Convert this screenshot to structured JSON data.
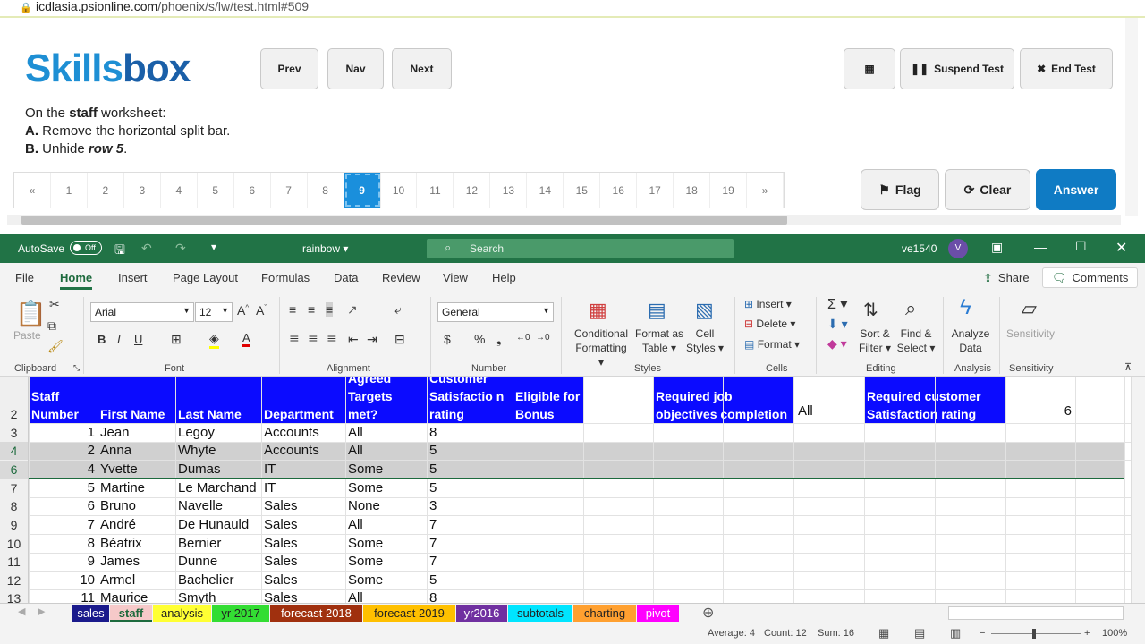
{
  "browser": {
    "url_host": "icdlasia.psionline.com",
    "url_path": "/phoenix/s/lw/test.html#509"
  },
  "skillsbox": {
    "logo_part1": "Skills",
    "logo_part2": "box",
    "nav": {
      "prev": "Prev",
      "nav": "Nav",
      "next": "Next"
    },
    "calculator_icon": "calculator-icon",
    "suspend": "Suspend Test",
    "end": "End Test",
    "instruction": {
      "intro_pre": "On the ",
      "intro_bold": "staff",
      "intro_post": " worksheet:",
      "a_label": "A.",
      "a_text": " Remove the horizontal split bar.",
      "b_label": "B.",
      "b_text_pre": " Unhide ",
      "b_text_bold": "row 5",
      "b_text_post": "."
    },
    "pages": [
      "«",
      "1",
      "2",
      "3",
      "4",
      "5",
      "6",
      "7",
      "8",
      "9",
      "10",
      "11",
      "12",
      "13",
      "14",
      "15",
      "16",
      "17",
      "18",
      "19",
      "»"
    ],
    "active_page": "9",
    "flag": "Flag",
    "clear": "Clear",
    "answer": "Answer"
  },
  "excel": {
    "autosave": "AutoSave",
    "autosave_state": "Off",
    "filename": "rainbow",
    "search_placeholder": "Search",
    "user": "ve1540",
    "user_initial": "V",
    "menu": [
      "File",
      "Home",
      "Insert",
      "Page Layout",
      "Formulas",
      "Data",
      "Review",
      "View",
      "Help"
    ],
    "share": "Share",
    "comments": "Comments",
    "ribbon": {
      "paste": "Paste",
      "clipboard": "Clipboard",
      "font_name": "Arial",
      "font_size": "12",
      "font": "Font",
      "alignment": "Alignment",
      "number_format": "General",
      "number": "Number",
      "cond_fmt_1": "Conditional",
      "cond_fmt_2": "Formatting",
      "fmt_table_1": "Format as",
      "fmt_table_2": "Table",
      "cell_styles_1": "Cell",
      "cell_styles_2": "Styles",
      "styles": "Styles",
      "insert": "Insert",
      "delete": "Delete",
      "format": "Format",
      "cells": "Cells",
      "sort_1": "Sort &",
      "sort_2": "Filter",
      "find_1": "Find &",
      "find_2": "Select",
      "editing": "Editing",
      "analyze_1": "Analyze",
      "analyze_2": "Data",
      "analysis": "Analysis",
      "sensitivity": "Sensitivity",
      "sensitivity_grp": "Sensitivity"
    },
    "sheet": {
      "row_numbers": [
        "2",
        "3",
        "4",
        "6",
        "7",
        "8",
        "9",
        "10",
        "11",
        "12",
        "13"
      ],
      "header": {
        "staff_number": "Staff Number",
        "first_name": "First Name",
        "last_name": "Last Name",
        "department": "Department",
        "agreed": "Agreed Targets met?",
        "customer": "Customer Satisfactio n rating",
        "eligible": "Eligible for Bonus",
        "required_job": "Required job objectives completion",
        "all": "All",
        "required_cust": "Required customer Satisfaction rating",
        "six": "6"
      },
      "rows": [
        {
          "no": "1",
          "first": "Jean",
          "last": "Legoy",
          "dept": "Accounts",
          "met": "All",
          "rating": "8"
        },
        {
          "no": "2",
          "first": "Anna",
          "last": "Whyte",
          "dept": "Accounts",
          "met": "All",
          "rating": "5"
        },
        {
          "no": "4",
          "first": "Yvette",
          "last": "Dumas",
          "dept": "IT",
          "met": "Some",
          "rating": "5"
        },
        {
          "no": "5",
          "first": "Martine",
          "last": "Le Marchand",
          "dept": "IT",
          "met": "Some",
          "rating": "5"
        },
        {
          "no": "6",
          "first": "Bruno",
          "last": "Navelle",
          "dept": "Sales",
          "met": "None",
          "rating": "3"
        },
        {
          "no": "7",
          "first": "André",
          "last": "De Hunauld",
          "dept": "Sales",
          "met": "All",
          "rating": "7"
        },
        {
          "no": "8",
          "first": "Béatrix",
          "last": "Bernier",
          "dept": "Sales",
          "met": "Some",
          "rating": "7"
        },
        {
          "no": "9",
          "first": "James",
          "last": "Dunne",
          "dept": "Sales",
          "met": "Some",
          "rating": "7"
        },
        {
          "no": "10",
          "first": "Armel",
          "last": "Bachelier",
          "dept": "Sales",
          "met": "Some",
          "rating": "5"
        },
        {
          "no": "11",
          "first": "Maurice",
          "last": "Smyth",
          "dept": "Sales",
          "met": "All",
          "rating": "8"
        }
      ]
    },
    "tabs": [
      {
        "name": "sales",
        "bg": "#1a1a8c",
        "fg": "#ffffff"
      },
      {
        "name": "staff",
        "bg": "#f6c9c9",
        "fg": "#222222"
      },
      {
        "name": "analysis",
        "bg": "#ffff33",
        "fg": "#222222"
      },
      {
        "name": "yr 2017",
        "bg": "#33dd33",
        "fg": "#222222"
      },
      {
        "name": "forecast 2018",
        "bg": "#a0300e",
        "fg": "#ffffff"
      },
      {
        "name": "forecast 2019",
        "bg": "#ffc000",
        "fg": "#222222"
      },
      {
        "name": "yr2016",
        "bg": "#7030a0",
        "fg": "#ffffff"
      },
      {
        "name": "subtotals",
        "bg": "#00e5ff",
        "fg": "#222222"
      },
      {
        "name": "charting",
        "bg": "#ffa030",
        "fg": "#222222"
      },
      {
        "name": "pivot",
        "bg": "#ff00ff",
        "fg": "#ffffff"
      }
    ],
    "status": {
      "average": "Average: 4",
      "count": "Count: 12",
      "sum": "Sum: 16",
      "zoom": "100%"
    }
  }
}
